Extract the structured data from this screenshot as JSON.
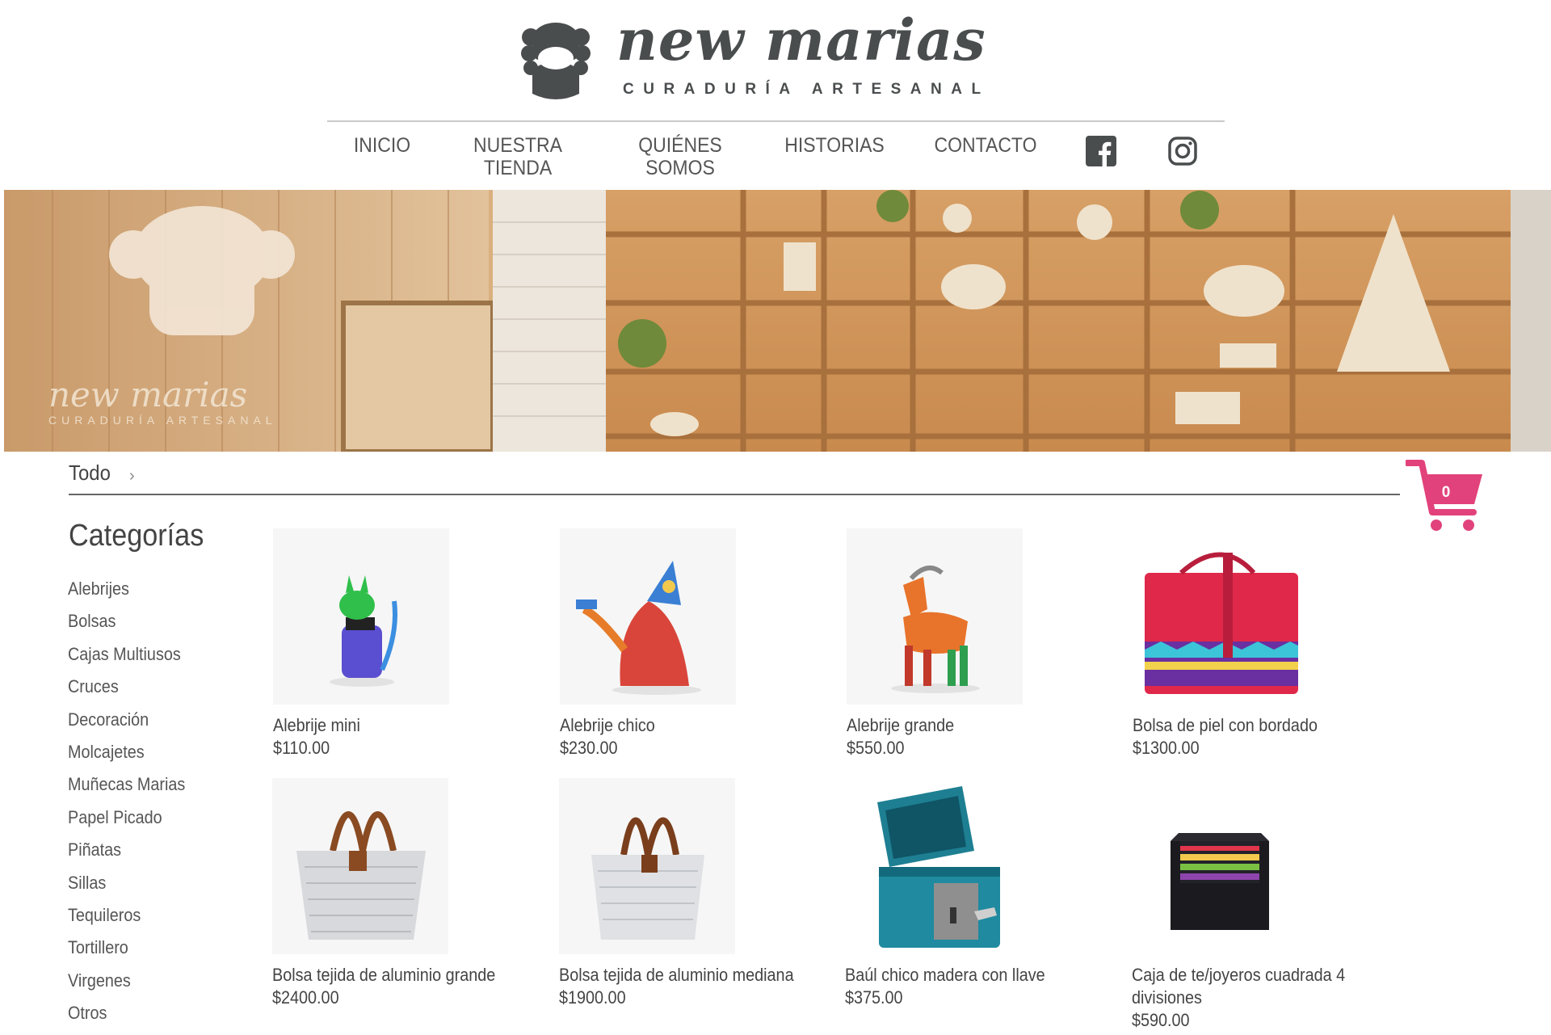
{
  "brand": {
    "name": "new marias",
    "tagline": "CURADURÍA ARTESANAL"
  },
  "nav": {
    "items": [
      {
        "line1": "INICIO",
        "line2": ""
      },
      {
        "line1": "NUESTRA",
        "line2": "TIENDA"
      },
      {
        "line1": "QUIÉNES",
        "line2": "SOMOS"
      },
      {
        "line1": "HISTORIAS",
        "line2": ""
      },
      {
        "line1": "CONTACTO",
        "line2": ""
      }
    ],
    "social": [
      "facebook-icon",
      "instagram-icon"
    ]
  },
  "hero": {
    "sign_name": "new marias",
    "sign_tagline": "CURADURÍA ARTESANAL"
  },
  "breadcrumb": {
    "current": "Todo",
    "separator": "›"
  },
  "cart": {
    "count": "0",
    "color": "#e2427b"
  },
  "sidebar": {
    "title": "Categorías",
    "categories": [
      "Alebrijes",
      "Bolsas",
      "Cajas Multiusos",
      "Cruces",
      "Decoración",
      "Molcajetes",
      "Muñecas Marias",
      "Papel Picado",
      "Piñatas",
      "Sillas",
      "Tequileros",
      "Tortillero",
      "Virgenes",
      "Otros"
    ]
  },
  "products": [
    {
      "name": "Alebrije mini",
      "price": "$110.00"
    },
    {
      "name": "Alebrije chico",
      "price": "$230.00"
    },
    {
      "name": "Alebrije grande",
      "price": "$550.00"
    },
    {
      "name": "Bolsa de piel con bordado",
      "price": "$1300.00"
    },
    {
      "name": "Bolsa tejida de aluminio grande",
      "price": "$2400.00"
    },
    {
      "name": "Bolsa tejida de aluminio mediana",
      "price": "$1900.00"
    },
    {
      "name": "Baúl chico madera con llave",
      "price": "$375.00"
    },
    {
      "name": "Caja de te/joyeros cuadrada 4 divisiones",
      "price": "$590.00"
    }
  ]
}
